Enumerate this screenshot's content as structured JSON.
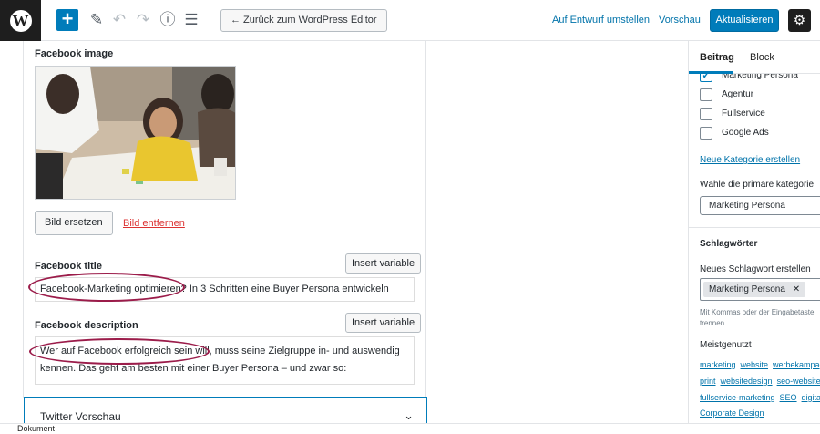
{
  "toolbar": {
    "add_label": "+",
    "back_label": "← Zurück zum WordPress Editor",
    "draft_label": "Auf Entwurf umstellen",
    "preview_label": "Vorschau",
    "update_label": "Aktualisieren"
  },
  "facebook": {
    "image_label": "Facebook image",
    "replace_label": "Bild ersetzen",
    "remove_label": "Bild entfernen",
    "title_label": "Facebook title",
    "title_value": "Facebook-Marketing optimieren? In 3 Schritten eine Buyer Persona entwickeln",
    "insert_variable_label": "Insert variable",
    "description_label": "Facebook description",
    "description_value": "Wer auf Facebook erfolgreich sein will, muss seine Zielgruppe in- und auswendig kennen. Das geht am besten mit einer Buyer Persona – und zwar so:"
  },
  "twitter": {
    "section_label": "Twitter Vorschau"
  },
  "sidebar": {
    "tab_post": "Beitrag",
    "tab_block": "Block",
    "categories": [
      {
        "label": "Marketing Persona",
        "checked": true
      },
      {
        "label": "Agentur",
        "checked": false
      },
      {
        "label": "Fullservice",
        "checked": false
      },
      {
        "label": "Google Ads",
        "checked": false
      }
    ],
    "new_category_link": "Neue Kategorie erstellen",
    "primary_category_label": "Wähle die primäre kategorie",
    "primary_category_value": "Marketing Persona",
    "tags_heading": "Schlagwörter",
    "new_tag_label": "Neues Schlagwort erstellen",
    "tag_chip": "Marketing Persona",
    "tag_remove": "✕",
    "tags_help": "Mit Kommas oder der Eingabetaste trennen.",
    "popular_heading": "Meistgenutzt",
    "popular_rows": [
      [
        "marketing",
        "website",
        "werbekampagne"
      ],
      [
        "print",
        "websitedesign",
        "seo-website"
      ],
      [
        "fullservice-marketing",
        "SEO",
        "digital"
      ],
      [
        "Corporate Design"
      ]
    ]
  },
  "footer": {
    "label": "Dokument"
  },
  "colors": {
    "accent": "#007cba",
    "annotation_oval": "#9b1c4a",
    "remove_link": "#dc3232"
  }
}
